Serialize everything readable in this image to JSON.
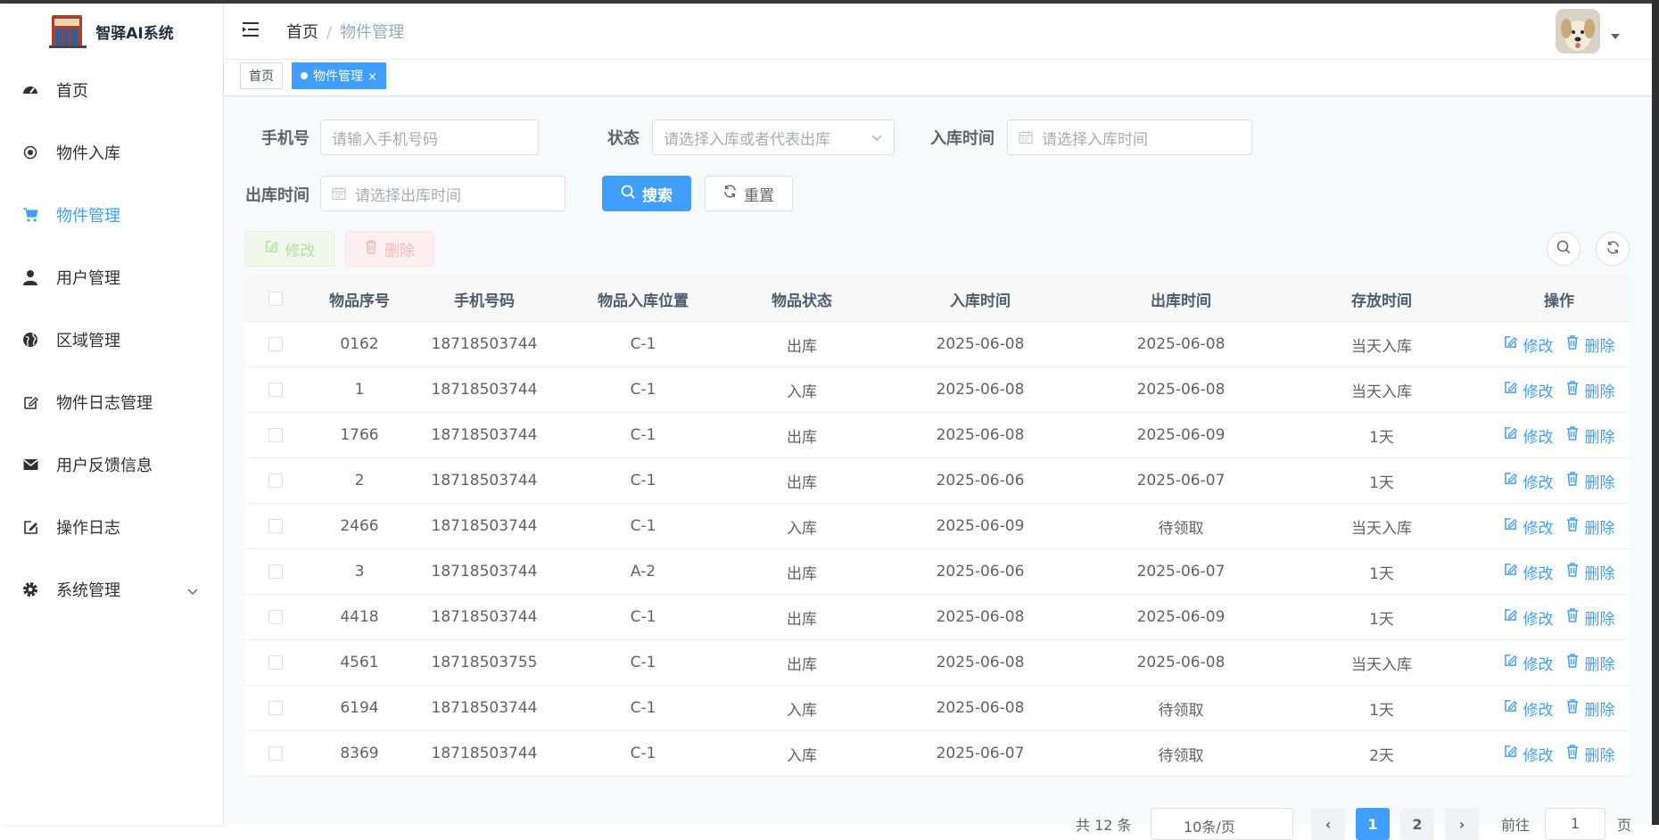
{
  "app": {
    "title": "智驿AI系统"
  },
  "sidebar": {
    "items": [
      {
        "label": "首页",
        "icon": "dashboard-icon"
      },
      {
        "label": "物件入库",
        "icon": "radio-dot-icon"
      },
      {
        "label": "物件管理",
        "icon": "cart-icon",
        "active": true
      },
      {
        "label": "用户管理",
        "icon": "user-icon"
      },
      {
        "label": "区域管理",
        "icon": "globe-icon"
      },
      {
        "label": "物件日志管理",
        "icon": "edit-log-icon"
      },
      {
        "label": "用户反馈信息",
        "icon": "mail-icon"
      },
      {
        "label": "操作日志",
        "icon": "form-edit-icon"
      },
      {
        "label": "系统管理",
        "icon": "gear-icon",
        "expandable": true
      }
    ]
  },
  "navbar": {
    "breadcrumb_home": "首页",
    "breadcrumb_sep": "/",
    "breadcrumb_current": "物件管理"
  },
  "tags": {
    "home": "首页",
    "current": "物件管理",
    "close": "×"
  },
  "search": {
    "phone_label": "手机号",
    "phone_placeholder": "请输入手机号码",
    "status_label": "状态",
    "status_placeholder": "请选择入库或者代表出库",
    "in_time_label": "入库时间",
    "in_time_placeholder": "请选择入库时间",
    "out_time_label": "出库时间",
    "out_time_placeholder": "请选择出库时间",
    "search_button": "搜索",
    "reset_button": "重置"
  },
  "toolbar": {
    "edit_button": "修改",
    "delete_button": "删除"
  },
  "table": {
    "headers": [
      "物品序号",
      "手机号码",
      "物品入库位置",
      "物品状态",
      "入库时间",
      "出库时间",
      "存放时间",
      "操作"
    ],
    "edit_label": "修改",
    "delete_label": "删除",
    "rows": [
      {
        "id": "0162",
        "phone": "18718503744",
        "location": "C-1",
        "status": "出库",
        "in_time": "2025-06-08",
        "out_time": "2025-06-08",
        "duration": "当天入库"
      },
      {
        "id": "1",
        "phone": "18718503744",
        "location": "C-1",
        "status": "入库",
        "in_time": "2025-06-08",
        "out_time": "2025-06-08",
        "duration": "当天入库"
      },
      {
        "id": "1766",
        "phone": "18718503744",
        "location": "C-1",
        "status": "出库",
        "in_time": "2025-06-08",
        "out_time": "2025-06-09",
        "duration": "1天"
      },
      {
        "id": "2",
        "phone": "18718503744",
        "location": "C-1",
        "status": "出库",
        "in_time": "2025-06-06",
        "out_time": "2025-06-07",
        "duration": "1天"
      },
      {
        "id": "2466",
        "phone": "18718503744",
        "location": "C-1",
        "status": "入库",
        "in_time": "2025-06-09",
        "out_time": "待领取",
        "duration": "当天入库"
      },
      {
        "id": "3",
        "phone": "18718503744",
        "location": "A-2",
        "status": "出库",
        "in_time": "2025-06-06",
        "out_time": "2025-06-07",
        "duration": "1天"
      },
      {
        "id": "4418",
        "phone": "18718503744",
        "location": "C-1",
        "status": "出库",
        "in_time": "2025-06-08",
        "out_time": "2025-06-09",
        "duration": "1天"
      },
      {
        "id": "4561",
        "phone": "18718503755",
        "location": "C-1",
        "status": "出库",
        "in_time": "2025-06-08",
        "out_time": "2025-06-08",
        "duration": "当天入库"
      },
      {
        "id": "6194",
        "phone": "18718503744",
        "location": "C-1",
        "status": "入库",
        "in_time": "2025-06-08",
        "out_time": "待领取",
        "duration": "1天"
      },
      {
        "id": "8369",
        "phone": "18718503744",
        "location": "C-1",
        "status": "入库",
        "in_time": "2025-06-07",
        "out_time": "待领取",
        "duration": "2天"
      }
    ]
  },
  "pagination": {
    "total": "共 12 条",
    "page_size": "10条/页",
    "prev": "‹",
    "pages": [
      "1",
      "2"
    ],
    "next": "›",
    "goto_label": "前往",
    "goto_value": "1",
    "goto_unit": "页"
  },
  "colors": {
    "primary": "#409eff",
    "sidebar_bg": "#ffffff",
    "main_bg": "#f8f9fb"
  }
}
